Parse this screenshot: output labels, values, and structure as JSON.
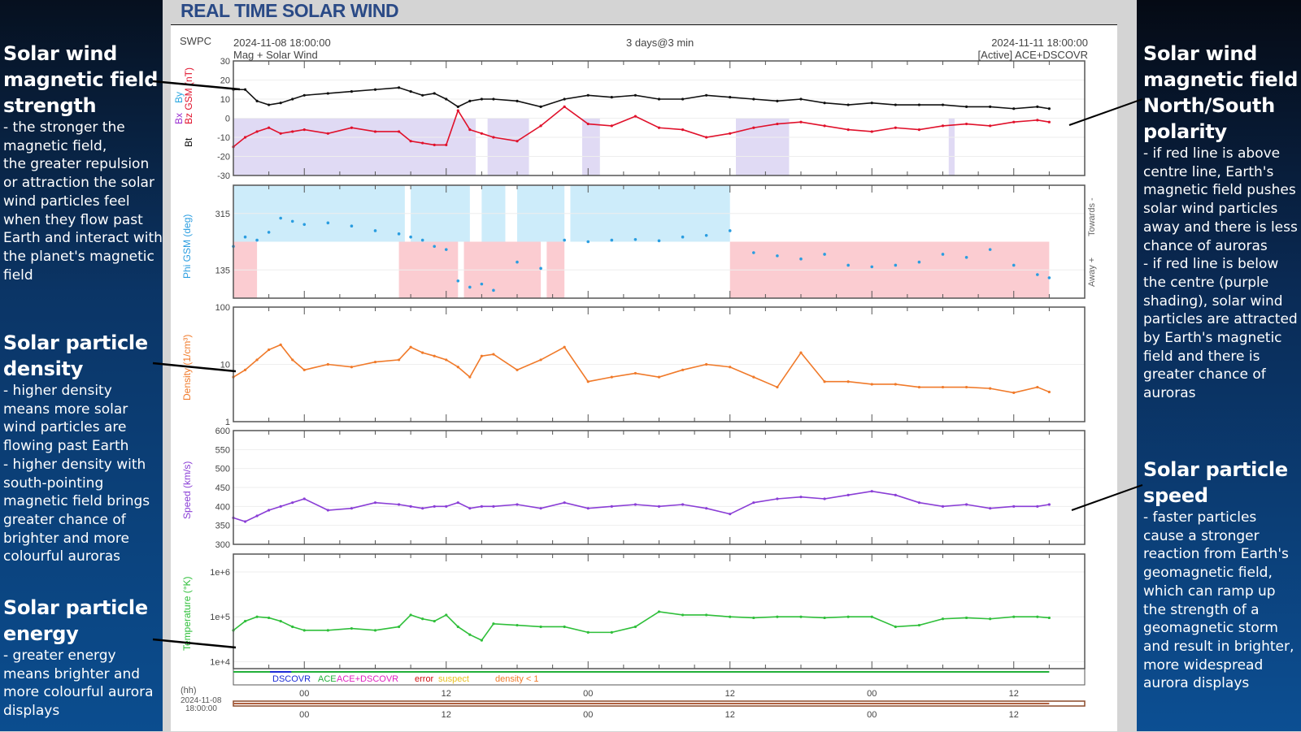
{
  "header": {
    "title": "REAL TIME SOLAR WIND",
    "source": "SWPC",
    "start_time": "2024-11-08 18:00:00",
    "end_time": "2024-11-11 18:00:00",
    "span": "3 days@3 min",
    "product": "Mag + Solar Wind",
    "active_source": "[Active] ACE+DSCOVR"
  },
  "left_notes": [
    {
      "title": "Solar wind magnetic field strength",
      "body": "- the stronger the magnetic field,\nthe greater repulsion or attraction the solar wind particles feel when they flow past Earth and interact with the planet's magnetic field"
    },
    {
      "title": "Solar particle density",
      "body": "- higher density means more solar wind particles are flowing past Earth\n- higher density with south-pointing magnetic field brings greater chance of brighter and more colourful auroras"
    },
    {
      "title": "Solar particle energy",
      "body": "- greater energy means brighter and more colourful aurora displays"
    }
  ],
  "right_notes": [
    {
      "title": "Solar wind magnetic field North/South polarity",
      "body": "- if red line is above centre line, Earth's magnetic field pushes solar wind particles away and there is less chance of auroras\n- if red line is below the centre (purple shading), solar wind particles are attracted by Earth's magnetic field and there is greater chance of auroras"
    },
    {
      "title": "Solar particle speed",
      "body": "- faster particles cause a stronger reaction from Earth's geomagnetic field, which can ramp up the strength of a geomagnetic storm and result in brighter, more widespread aurora displays"
    }
  ],
  "colors": {
    "bt": "#111111",
    "bz": "#e0112b",
    "bx": "#9b30d0",
    "by": "#2aa7e0",
    "bz_south_shade": "#ddd6f3",
    "phi": "#2a9de0",
    "phi_towards_shade": "#c8eafa",
    "phi_away_shade": "#fbc6cc",
    "density": "#f07a2a",
    "speed": "#8a3ed6",
    "temperature": "#2fbf3a",
    "dscovr": "#1b2bd6",
    "ace": "#22b03a",
    "ace_dscovr": "#e020c0",
    "error": "#d01010",
    "suspect": "#e8c020",
    "density_lt1": "#f07a2a"
  },
  "legend": {
    "dscovr": "DSCOVR",
    "ace": "ACE",
    "ace_dscovr": "ACE+DSCOVR",
    "error": "error",
    "suspect": "suspect",
    "density_lt1": "density < 1"
  },
  "time_axis": {
    "unit_label": "(hh)",
    "start_date": "2024-11-08",
    "start_clock": "18:00:00",
    "tick_labels": [
      "00",
      "12",
      "00",
      "12",
      "00",
      "12"
    ],
    "tick_hours_from_start": [
      6,
      18,
      30,
      42,
      54,
      66
    ],
    "total_hours": 72,
    "data_end_hour": 69
  },
  "chart_data": [
    {
      "type": "line",
      "name": "magnetic-field",
      "ylabel_parts": [
        "Bt",
        "Bx",
        "By",
        "Bz GSM (nT)"
      ],
      "ylim": [
        -30,
        30
      ],
      "yticks": [
        30,
        20,
        10,
        0,
        -10,
        -20,
        -30
      ],
      "x_hours": [
        0,
        1,
        2,
        3,
        4,
        5,
        6,
        8,
        10,
        12,
        14,
        15,
        16,
        17,
        18,
        19,
        20,
        21,
        22,
        24,
        26,
        28,
        30,
        32,
        34,
        36,
        38,
        40,
        42,
        44,
        46,
        48,
        50,
        52,
        54,
        56,
        58,
        60,
        62,
        64,
        66,
        68,
        69
      ],
      "series": [
        {
          "name": "Bt",
          "values": [
            15,
            15,
            9,
            7,
            8,
            10,
            12,
            13,
            14,
            15,
            16,
            14,
            12,
            13,
            10,
            6,
            9,
            10,
            10,
            9,
            6,
            10,
            12,
            11,
            12,
            10,
            10,
            12,
            11,
            10,
            9,
            10,
            8,
            7,
            8,
            7,
            7,
            7,
            6,
            6,
            5,
            6,
            5
          ]
        },
        {
          "name": "Bz",
          "values": [
            -15,
            -10,
            -7,
            -5,
            -8,
            -7,
            -6,
            -8,
            -5,
            -7,
            -7,
            -12,
            -13,
            -14,
            -14,
            4,
            -6,
            -8,
            -10,
            -12,
            -4,
            6,
            -3,
            -4,
            1,
            -5,
            -6,
            -10,
            -8,
            -5,
            -3,
            -2,
            -4,
            -6,
            -7,
            -5,
            -6,
            -4,
            -3,
            -4,
            -2,
            -1,
            -2
          ]
        }
      ],
      "south_shade_hours": [
        [
          0,
          20.5
        ],
        [
          21.5,
          25
        ],
        [
          29.5,
          31
        ],
        [
          42.5,
          47
        ],
        [
          60.5,
          61
        ]
      ]
    },
    {
      "type": "scatter",
      "name": "phi-angle",
      "ylabel": "Phi GSM (deg)",
      "right_labels": [
        "Towards -",
        "Away +"
      ],
      "ylim": [
        45,
        405
      ],
      "yticks": [
        315,
        135
      ],
      "x_hours": [
        0,
        1,
        2,
        3,
        4,
        5,
        6,
        8,
        10,
        12,
        14,
        15,
        16,
        17,
        18,
        19,
        20,
        21,
        22,
        24,
        26,
        28,
        30,
        32,
        34,
        36,
        38,
        40,
        42,
        44,
        46,
        48,
        50,
        52,
        54,
        56,
        58,
        60,
        62,
        64,
        66,
        68,
        69
      ],
      "values": [
        210,
        240,
        230,
        255,
        300,
        290,
        280,
        285,
        275,
        260,
        250,
        240,
        230,
        210,
        200,
        100,
        80,
        90,
        70,
        160,
        140,
        230,
        225,
        230,
        232,
        228,
        240,
        245,
        260,
        190,
        180,
        170,
        185,
        150,
        145,
        150,
        160,
        185,
        175,
        200,
        150,
        120,
        110
      ],
      "towards_shade_hours": [
        [
          0,
          14.5
        ],
        [
          15,
          20
        ],
        [
          21,
          23
        ],
        [
          24,
          28
        ],
        [
          28.5,
          42
        ]
      ],
      "away_shade_hours": [
        [
          0,
          2
        ],
        [
          14,
          19
        ],
        [
          19.5,
          26
        ],
        [
          26.5,
          28
        ],
        [
          42,
          69
        ]
      ]
    },
    {
      "type": "line",
      "name": "density",
      "ylabel": "Density (1/cm³)",
      "yscale": "log",
      "ylim": [
        1,
        100
      ],
      "yticks": [
        100,
        10,
        1
      ],
      "x_hours": [
        0,
        1,
        2,
        3,
        4,
        5,
        6,
        8,
        10,
        12,
        14,
        15,
        16,
        17,
        18,
        19,
        20,
        21,
        22,
        24,
        26,
        28,
        30,
        32,
        34,
        36,
        38,
        40,
        42,
        44,
        46,
        48,
        50,
        52,
        54,
        56,
        58,
        60,
        62,
        64,
        66,
        68,
        69
      ],
      "values": [
        6,
        8,
        12,
        18,
        22,
        12,
        8,
        10,
        9,
        11,
        12,
        20,
        16,
        14,
        12,
        9,
        6,
        14,
        15,
        8,
        12,
        20,
        5,
        6,
        7,
        6,
        8,
        10,
        9,
        6,
        4,
        16,
        5,
        5,
        4.5,
        4.5,
        4,
        4,
        4,
        3.8,
        3.2,
        4,
        3.3
      ]
    },
    {
      "type": "line",
      "name": "speed",
      "ylabel": "Speed (km/s)",
      "ylim": [
        300,
        600
      ],
      "yticks": [
        600,
        550,
        500,
        450,
        400,
        350,
        300
      ],
      "x_hours": [
        0,
        1,
        2,
        3,
        4,
        5,
        6,
        8,
        10,
        12,
        14,
        15,
        16,
        17,
        18,
        19,
        20,
        21,
        22,
        24,
        26,
        28,
        30,
        32,
        34,
        36,
        38,
        40,
        42,
        44,
        46,
        48,
        50,
        52,
        54,
        56,
        58,
        60,
        62,
        64,
        66,
        68,
        69
      ],
      "values": [
        370,
        360,
        375,
        390,
        400,
        410,
        420,
        390,
        395,
        410,
        405,
        400,
        395,
        400,
        400,
        410,
        395,
        400,
        400,
        405,
        395,
        410,
        395,
        400,
        405,
        400,
        405,
        395,
        380,
        410,
        420,
        425,
        420,
        430,
        440,
        430,
        410,
        400,
        405,
        395,
        400,
        400,
        405
      ]
    },
    {
      "type": "line",
      "name": "temperature",
      "ylabel": "Temperature (°K)",
      "yscale": "log",
      "ylim": [
        7000,
        2500000
      ],
      "yticks": [
        "1e+6",
        "1e+5",
        "1e+4"
      ],
      "ytick_values": [
        1000000,
        100000,
        10000
      ],
      "x_hours": [
        0,
        1,
        2,
        3,
        4,
        5,
        6,
        8,
        10,
        12,
        14,
        15,
        16,
        17,
        18,
        19,
        20,
        21,
        22,
        24,
        26,
        28,
        30,
        32,
        34,
        36,
        38,
        40,
        42,
        44,
        46,
        48,
        50,
        52,
        54,
        56,
        58,
        60,
        62,
        64,
        66,
        68,
        69
      ],
      "values": [
        50000,
        80000,
        100000,
        95000,
        80000,
        60000,
        50000,
        50000,
        55000,
        50000,
        60000,
        110000,
        90000,
        80000,
        110000,
        60000,
        40000,
        30000,
        70000,
        65000,
        60000,
        60000,
        45000,
        45000,
        60000,
        130000,
        110000,
        110000,
        100000,
        95000,
        100000,
        100000,
        95000,
        100000,
        100000,
        60000,
        65000,
        90000,
        95000,
        90000,
        100000,
        100000,
        95000
      ]
    }
  ]
}
